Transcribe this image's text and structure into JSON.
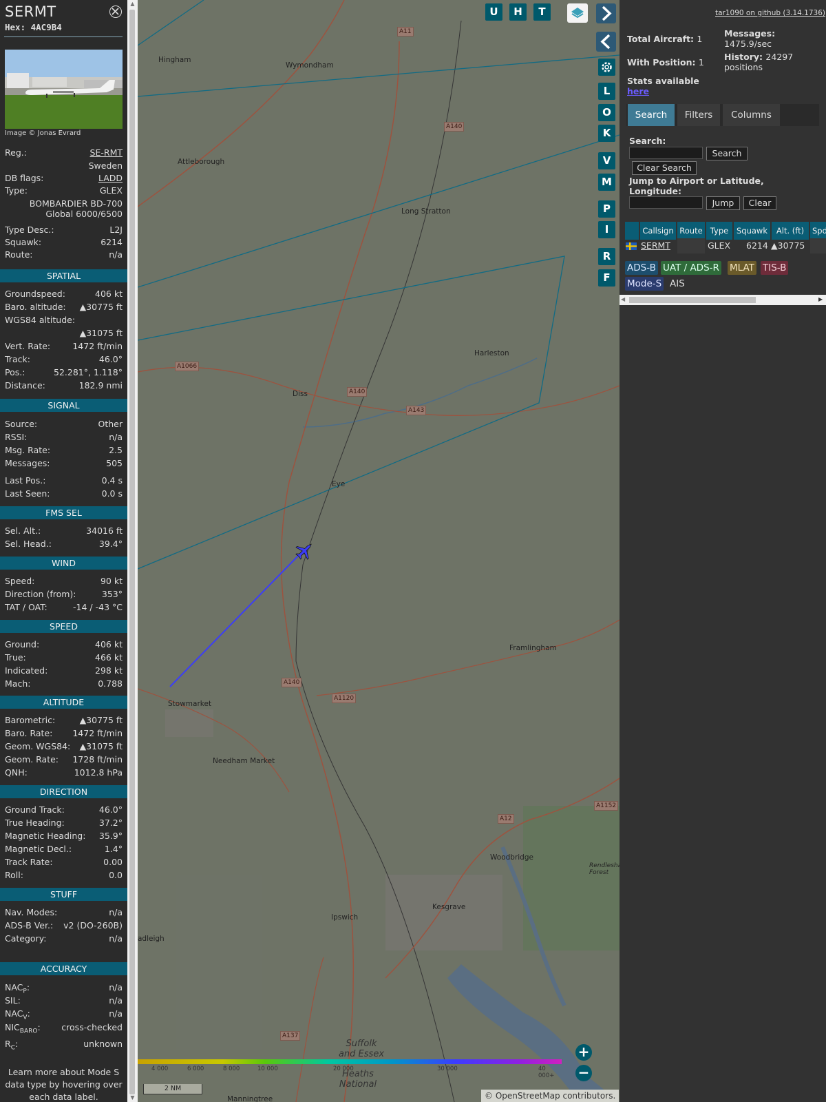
{
  "aircraft": {
    "callsign": "SERMT",
    "hex": "Hex: 4AC9B4",
    "photo_credit": "Image © Jonas Evrard"
  },
  "details": [
    {
      "k": "Reg.:",
      "v": "SE-RMT",
      "link": true
    },
    {
      "k": "",
      "v": "Sweden"
    },
    {
      "k": "DB flags:",
      "v": "LADD",
      "link": true
    },
    {
      "k": "Type:",
      "v": "GLEX"
    },
    {
      "k": "",
      "v": "BOMBARDIER BD-700"
    },
    {
      "k": "",
      "v": "Global 6000/6500"
    },
    {
      "k": "Type Desc.:",
      "v": "L2J"
    },
    {
      "k": "Squawk:",
      "v": "6214"
    },
    {
      "k": "Route:",
      "v": "n/a"
    }
  ],
  "sections": {
    "spatial": {
      "title": "SPATIAL",
      "rows": [
        {
          "k": "Groundspeed:",
          "v": "406 kt"
        },
        {
          "k": "Baro. altitude:",
          "v": "▲30775 ft"
        },
        {
          "k": "WGS84 altitude:",
          "v": ""
        },
        {
          "k": "",
          "v": "▲31075 ft"
        },
        {
          "k": "Vert. Rate:",
          "v": "1472 ft/min"
        },
        {
          "k": "Track:",
          "v": "46.0°"
        },
        {
          "k": "Pos.:",
          "v": "52.281°, 1.118°"
        },
        {
          "k": "Distance:",
          "v": "182.9 nmi"
        }
      ]
    },
    "signal": {
      "title": "SIGNAL",
      "rows": [
        {
          "k": "Source:",
          "v": "Other"
        },
        {
          "k": "RSSI:",
          "v": "n/a"
        },
        {
          "k": "Msg. Rate:",
          "v": "2.5"
        },
        {
          "k": "Messages:",
          "v": "505"
        },
        {
          "k": "Last Pos.:",
          "v": "0.4 s"
        },
        {
          "k": "Last Seen:",
          "v": "0.0 s"
        }
      ]
    },
    "fms": {
      "title": "FMS SEL",
      "rows": [
        {
          "k": "Sel. Alt.:",
          "v": "34016 ft"
        },
        {
          "k": "Sel. Head.:",
          "v": "39.4°"
        }
      ]
    },
    "wind": {
      "title": "WIND",
      "rows": [
        {
          "k": "Speed:",
          "v": "90 kt"
        },
        {
          "k": "Direction (from):",
          "v": "353°"
        },
        {
          "k": "TAT / OAT:",
          "v": "-14 / -43 °C"
        }
      ]
    },
    "speed": {
      "title": "SPEED",
      "rows": [
        {
          "k": "Ground:",
          "v": "406 kt"
        },
        {
          "k": "True:",
          "v": "466 kt"
        },
        {
          "k": "Indicated:",
          "v": "298 kt"
        },
        {
          "k": "Mach:",
          "v": "0.788"
        }
      ]
    },
    "altitude": {
      "title": "ALTITUDE",
      "rows": [
        {
          "k": "Barometric:",
          "v": "▲30775 ft"
        },
        {
          "k": "Baro. Rate:",
          "v": "1472 ft/min"
        },
        {
          "k": "Geom. WGS84:",
          "v": "▲31075 ft"
        },
        {
          "k": "Geom. Rate:",
          "v": "1728 ft/min"
        },
        {
          "k": "QNH:",
          "v": "1012.8 hPa"
        }
      ]
    },
    "direction": {
      "title": "DIRECTION",
      "rows": [
        {
          "k": "Ground Track:",
          "v": "46.0°"
        },
        {
          "k": "True Heading:",
          "v": "37.2°"
        },
        {
          "k": "Magnetic Heading:",
          "v": "35.9°"
        },
        {
          "k": "Magnetic Decl.:",
          "v": "1.4°"
        },
        {
          "k": "Track Rate:",
          "v": "0.00"
        },
        {
          "k": "Roll:",
          "v": "0.0"
        }
      ]
    },
    "stuff": {
      "title": "STUFF",
      "rows": [
        {
          "k": "Nav. Modes:",
          "v": "n/a"
        },
        {
          "k": "ADS-B Ver.:",
          "v": "v2 (DO-260B)"
        },
        {
          "k": "Category:",
          "v": "n/a"
        }
      ]
    },
    "accuracy": {
      "title": "ACCURACY",
      "rows": [
        {
          "k": "NACP:",
          "v": "n/a"
        },
        {
          "k": "SIL:",
          "v": "n/a"
        },
        {
          "k": "NACV:",
          "v": "n/a"
        },
        {
          "k": "NICBARO:",
          "v": "cross-checked"
        },
        {
          "k": "RC:",
          "v": "unknown"
        }
      ]
    }
  },
  "learn_more": "Learn more about Mode S data type by hovering over each data label.",
  "map": {
    "top_buttons": [
      "U",
      "H",
      "T"
    ],
    "side_buttons": [
      "L",
      "O",
      "K",
      "V",
      "M",
      "P",
      "I",
      "R",
      "F"
    ],
    "places": {
      "hingham": "Hingham",
      "wymondham": "Wymondham",
      "attleborough": "Attleborough",
      "long_stratton": "Long Stratton",
      "harleston": "Harleston",
      "diss": "Diss",
      "eye": "Eye",
      "framlingham": "Framlingham",
      "stowmarket": "Stowmarket",
      "needham_market": "Needham Market",
      "woodbridge": "Woodbridge",
      "ipswich": "Ipswich",
      "kesgrave": "Kesgrave",
      "rendlesham_forest": "Rendlesham Forest",
      "suffolk_essex": "Suffolk and Essex",
      "heaths": "Heaths National",
      "adleigh": "adleigh",
      "manningtree": "Manningtree"
    },
    "roads": [
      "A11",
      "A140",
      "A1066",
      "A140",
      "A143",
      "A140",
      "A1120",
      "A1152",
      "A12",
      "A137"
    ],
    "altitude_legend": [
      "4 000",
      "6 000",
      "8 000",
      "10 000",
      "20 000",
      "30 000",
      "40 000+"
    ],
    "scale": "2 NM",
    "attribution": "© OpenStreetMap contributors."
  },
  "stats": {
    "github": "tar1090 on github (3.14.1736)",
    "total_label": "Total Aircraft:",
    "total": "1",
    "position_label": "With Position:",
    "position": "1",
    "messages_label": "Messages:",
    "messages": "1475.9/sec",
    "history_label": "History:",
    "history": "24297 positions",
    "stats_available": "Stats available",
    "here": "here"
  },
  "tabs": [
    "Search",
    "Filters",
    "Columns"
  ],
  "search": {
    "label": "Search:",
    "search_button": "Search",
    "clear_button": "Clear Search",
    "jump_label": "Jump to Airport or Latitude, Longitude:",
    "jump_button": "Jump",
    "clear2_button": "Clear"
  },
  "table": {
    "headers": [
      "Callsign",
      "Route",
      "Type",
      "Squawk",
      "Alt. (ft)",
      "Spd"
    ],
    "row": {
      "callsign": "SERMT",
      "route": "",
      "type": "GLEX",
      "squawk": "6214",
      "alt": "▲30775"
    }
  },
  "sources": [
    "ADS-B",
    "UAT / ADS-R",
    "MLAT",
    "TIS-B",
    "Mode-S",
    "AIS"
  ],
  "colors": {
    "section": "#0a5d75",
    "adsb": "#1d4e6e",
    "uat": "#2f6b3a",
    "mlat": "#6a5a2a",
    "tisb": "#6e2c3a",
    "modes": "#2b3c6e"
  }
}
